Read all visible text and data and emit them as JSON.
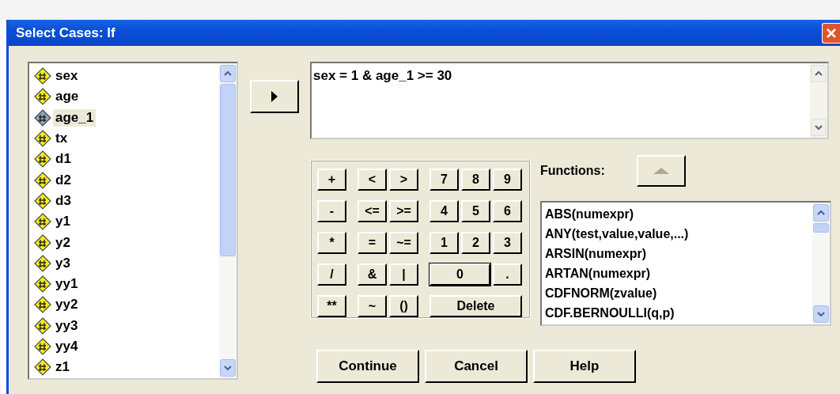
{
  "window": {
    "title": "Select Cases: If"
  },
  "variables": [
    {
      "name": "sex",
      "selected": false
    },
    {
      "name": "age",
      "selected": false
    },
    {
      "name": "age_1",
      "selected": true
    },
    {
      "name": "tx",
      "selected": false
    },
    {
      "name": "d1",
      "selected": false
    },
    {
      "name": "d2",
      "selected": false
    },
    {
      "name": "d3",
      "selected": false
    },
    {
      "name": "y1",
      "selected": false
    },
    {
      "name": "y2",
      "selected": false
    },
    {
      "name": "y3",
      "selected": false
    },
    {
      "name": "yy1",
      "selected": false
    },
    {
      "name": "yy2",
      "selected": false
    },
    {
      "name": "yy3",
      "selected": false
    },
    {
      "name": "yy4",
      "selected": false
    },
    {
      "name": "z1",
      "selected": false
    }
  ],
  "expression": "sex = 1 & age_1 >= 30",
  "keypad": [
    [
      [
        "+"
      ],
      [
        "<",
        ">"
      ],
      [
        "7",
        "8",
        "9"
      ]
    ],
    [
      [
        "-"
      ],
      [
        "<=",
        ">="
      ],
      [
        "4",
        "5",
        "6"
      ]
    ],
    [
      [
        "*"
      ],
      [
        "=",
        "~="
      ],
      [
        "1",
        "2",
        "3"
      ]
    ],
    [
      [
        "/"
      ],
      [
        "&",
        "|"
      ],
      [
        "0",
        "."
      ]
    ],
    [
      [
        "**"
      ],
      [
        "~",
        "()"
      ],
      [
        "Delete"
      ]
    ]
  ],
  "functions_label": "Functions:",
  "functions": [
    "ABS(numexpr)",
    "ANY(test,value,value,...)",
    "ARSIN(numexpr)",
    "ARTAN(numexpr)",
    "CDFNORM(zvalue)",
    "CDF.BERNOULLI(q,p)"
  ],
  "buttons": [
    "Continue",
    "Cancel",
    "Help"
  ]
}
